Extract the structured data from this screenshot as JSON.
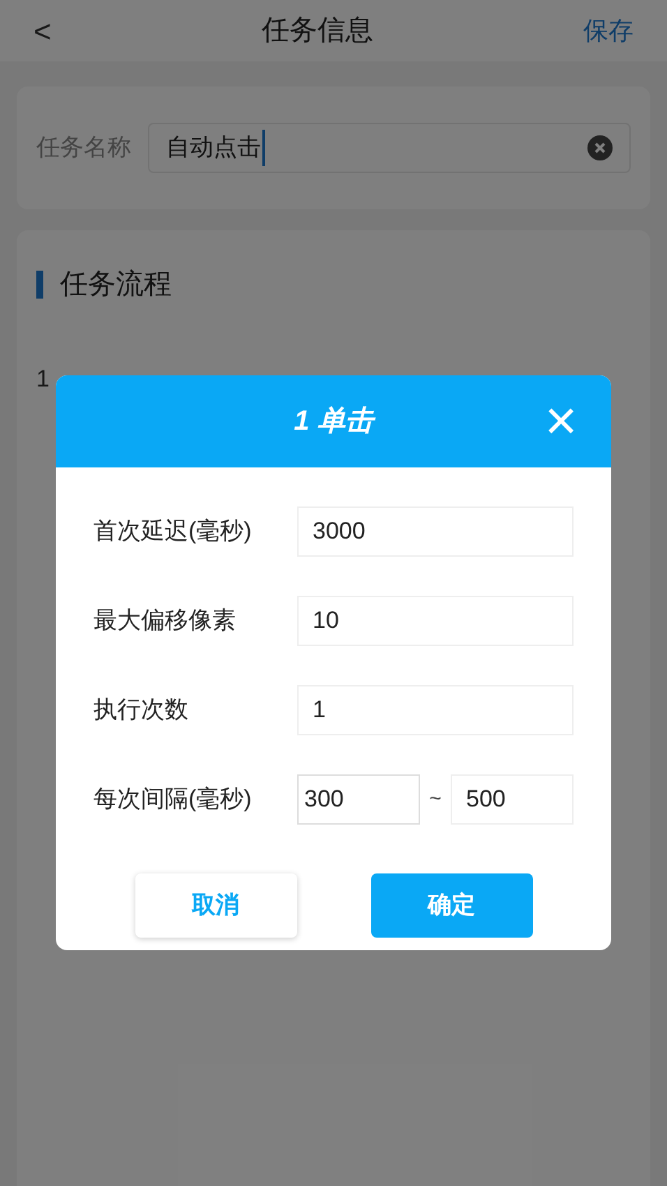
{
  "header": {
    "back": "<",
    "title": "任务信息",
    "save": "保存"
  },
  "task_name": {
    "label": "任务名称",
    "value": "自动点击"
  },
  "flow": {
    "title": "任务流程",
    "steps": [
      {
        "index": "1"
      }
    ]
  },
  "dialog": {
    "title": "1 单击",
    "close": "×",
    "fields": [
      {
        "kind": "single",
        "label": "首次延迟(毫秒)",
        "value": "3000"
      },
      {
        "kind": "single",
        "label": "最大偏移像素",
        "value": "10"
      },
      {
        "kind": "single",
        "label": "执行次数",
        "value": "1"
      },
      {
        "kind": "range",
        "label": "每次间隔(毫秒)",
        "value": "300",
        "separator": "~",
        "value_to": "500"
      }
    ],
    "cancel": "取消",
    "confirm": "确定"
  }
}
